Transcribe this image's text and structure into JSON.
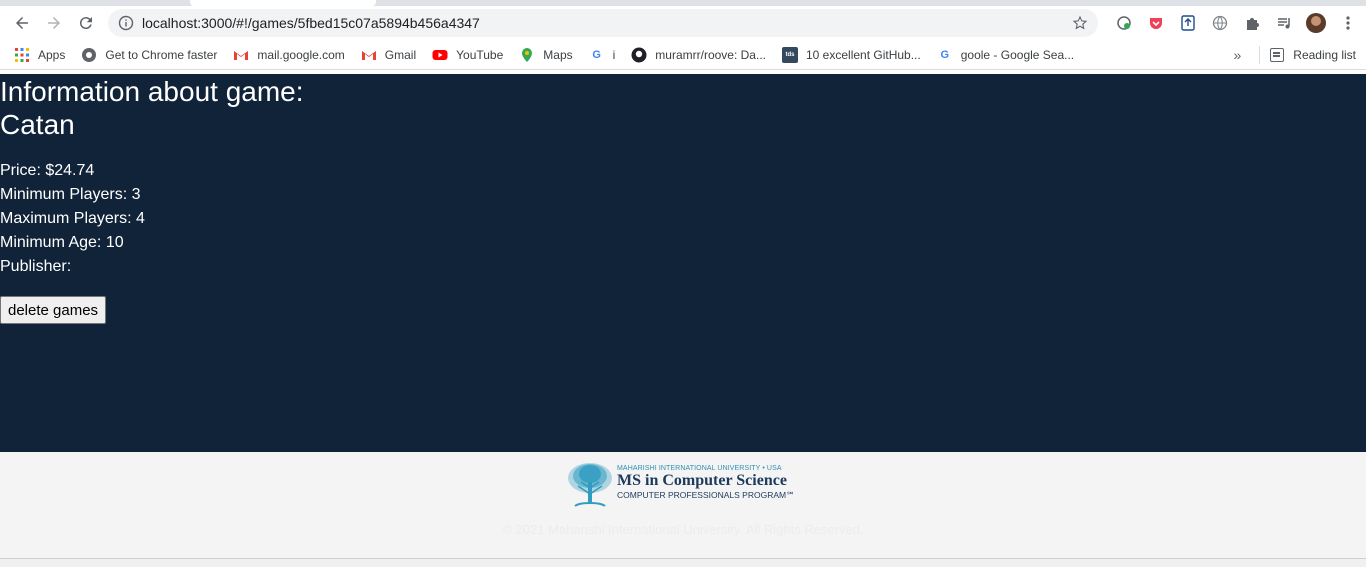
{
  "browser": {
    "url": "localhost:3000/#!/games/5fbed15c07a5894b456a4347",
    "icons": [
      "back-icon",
      "forward-icon",
      "reload-icon",
      "info-icon",
      "star-icon",
      "extension-icon",
      "puzzle-icon",
      "media-icon",
      "menu-icon"
    ],
    "reading_list_label": "Reading list"
  },
  "bookmarks": [
    {
      "label": "Apps",
      "icon": "apps-grid-icon"
    },
    {
      "label": "Get to Chrome faster",
      "icon": "chrome-icon"
    },
    {
      "label": "mail.google.com",
      "icon": "gmail-icon"
    },
    {
      "label": "Gmail",
      "icon": "gmail-icon"
    },
    {
      "label": "YouTube",
      "icon": "youtube-icon"
    },
    {
      "label": "Maps",
      "icon": "maps-icon"
    },
    {
      "label": "i",
      "icon": "google-icon"
    },
    {
      "label": "muramrr/roove: Da...",
      "icon": "github-icon"
    },
    {
      "label": "10 excellent GitHub...",
      "icon": "tds-icon"
    },
    {
      "label": "goole - Google Sea...",
      "icon": "google-icon"
    }
  ],
  "game": {
    "heading_line1": "Information about game:",
    "heading_line2": "Catan",
    "price": "Price: $24.74",
    "min_players": "Minimum Players: 3",
    "max_players": "Maximum Players: 4",
    "min_age": "Minimum Age: 10",
    "publisher": "Publisher:",
    "delete_label": "delete games"
  },
  "footer": {
    "university": "MAHARISHI INTERNATIONAL UNIVERSITY • USA",
    "program": "MS in Computer Science",
    "subprogram": "COMPUTER PROFESSIONALS PROGRAM℠",
    "copyright": "© 2021 Maharishi International University. All Rights Reserved."
  },
  "colors": {
    "page_background": "#102339",
    "footer_background": "#f4f4f4",
    "logo_teal": "#2f9cc0",
    "logo_navy": "#1d3a5c"
  }
}
